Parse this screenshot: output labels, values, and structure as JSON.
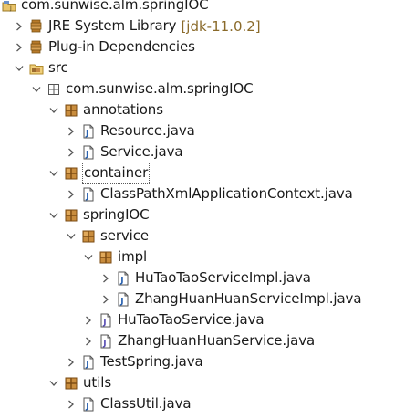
{
  "tree": [
    {
      "label": "com.sunwise.alm.springIOC",
      "decoration": "",
      "icon": "project-icon",
      "toggle": "none",
      "depth": 0
    },
    {
      "label": "JRE System Library",
      "decoration": "[jdk-11.0.2]",
      "icon": "library-icon",
      "toggle": "collapsed",
      "depth": 1
    },
    {
      "label": "Plug-in Dependencies",
      "decoration": "",
      "icon": "library-icon",
      "toggle": "collapsed",
      "depth": 1
    },
    {
      "label": "src",
      "decoration": "",
      "icon": "source-folder-icon",
      "toggle": "expanded",
      "depth": 1
    },
    {
      "label": "com.sunwise.alm.springIOC",
      "decoration": "",
      "icon": "empty-package-icon",
      "toggle": "expanded",
      "depth": 2
    },
    {
      "label": "annotations",
      "decoration": "",
      "icon": "package-icon",
      "toggle": "expanded",
      "depth": 3
    },
    {
      "label": "Resource.java",
      "decoration": "",
      "icon": "annotation-file-icon",
      "toggle": "collapsed",
      "depth": 4
    },
    {
      "label": "Service.java",
      "decoration": "",
      "icon": "annotation-file-icon",
      "toggle": "collapsed",
      "depth": 4
    },
    {
      "label": "container",
      "decoration": "",
      "icon": "package-icon",
      "toggle": "expanded",
      "depth": 3,
      "selected": true
    },
    {
      "label": "ClassPathXmlApplicationContext.java",
      "decoration": "",
      "icon": "java-file-icon",
      "toggle": "collapsed",
      "depth": 4
    },
    {
      "label": "springIOC",
      "decoration": "",
      "icon": "package-icon",
      "toggle": "expanded",
      "depth": 3
    },
    {
      "label": "service",
      "decoration": "",
      "icon": "package-icon",
      "toggle": "expanded",
      "depth": 4
    },
    {
      "label": "impl",
      "decoration": "",
      "icon": "package-icon",
      "toggle": "expanded",
      "depth": 5
    },
    {
      "label": "HuTaoTaoServiceImpl.java",
      "decoration": "",
      "icon": "java-file-icon",
      "toggle": "collapsed",
      "depth": 6
    },
    {
      "label": "ZhangHuanHuanServiceImpl.java",
      "decoration": "",
      "icon": "java-file-icon",
      "toggle": "collapsed",
      "depth": 6
    },
    {
      "label": "HuTaoTaoService.java",
      "decoration": "",
      "icon": "interface-file-icon",
      "toggle": "collapsed",
      "depth": 5
    },
    {
      "label": "ZhangHuanHuanService.java",
      "decoration": "",
      "icon": "interface-file-icon",
      "toggle": "collapsed",
      "depth": 5
    },
    {
      "label": "TestSpring.java",
      "decoration": "",
      "icon": "java-file-icon",
      "toggle": "collapsed",
      "depth": 4
    },
    {
      "label": "utils",
      "decoration": "",
      "icon": "package-icon",
      "toggle": "expanded",
      "depth": 3
    },
    {
      "label": "ClassUtil.java",
      "decoration": "",
      "icon": "java-file-icon",
      "toggle": "collapsed",
      "depth": 4
    }
  ],
  "colors": {
    "text": "#1a1a1a",
    "decoration": "#8a6a2a",
    "toggle": "#555555",
    "package_brown": "#9c6b2f",
    "folder_yellow": "#e3b95a",
    "java_blue": "#2a62b0"
  }
}
